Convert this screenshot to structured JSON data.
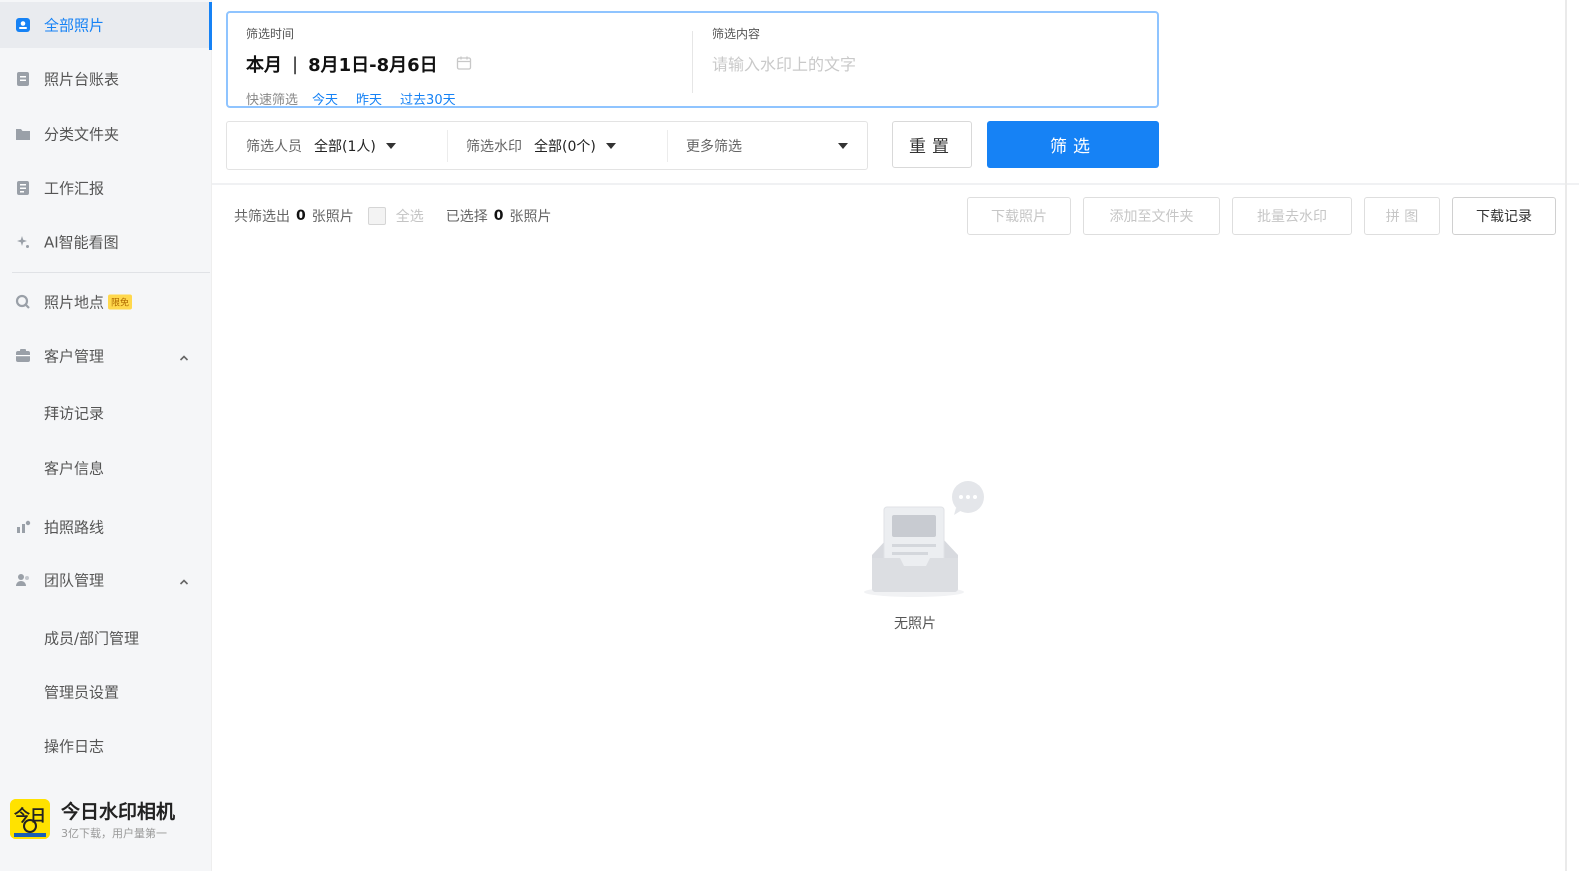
{
  "sidebar": {
    "items": [
      {
        "label": "全部照片",
        "icon": "photo-icon",
        "active": true
      },
      {
        "label": "照片台账表",
        "icon": "ledger-icon"
      },
      {
        "label": "分类文件夹",
        "icon": "folder-icon"
      },
      {
        "label": "工作汇报",
        "icon": "report-icon"
      },
      {
        "label": "AI智能看图",
        "icon": "ai-sparkle-icon"
      },
      {
        "label": "照片地点",
        "icon": "location-icon",
        "badge": "限免"
      },
      {
        "label": "客户管理",
        "icon": "customer-icon",
        "expanded": true
      },
      {
        "label": "拜访记录"
      },
      {
        "label": "客户信息"
      },
      {
        "label": "拍照路线",
        "icon": "route-icon"
      },
      {
        "label": "团队管理",
        "icon": "team-icon",
        "expanded": true
      },
      {
        "label": "成员/部门管理"
      },
      {
        "label": "管理员设置"
      },
      {
        "label": "操作日志"
      }
    ],
    "brand": {
      "name": "今日水印相机",
      "subtitle": "3亿下载，用户量第一",
      "logo_text": "今日"
    }
  },
  "filter": {
    "time_label": "筛选时间",
    "date_period": "本月",
    "date_range": "8月1日-8月6日",
    "quick_label": "快速筛选",
    "quick_links": [
      "今天",
      "昨天",
      "过去30天"
    ],
    "content_label": "筛选内容",
    "content_placeholder": "请输入水印上的文字",
    "content_value": ""
  },
  "filter_row": {
    "person_label": "筛选人员",
    "person_value": "全部(1人)",
    "watermark_label": "筛选水印",
    "watermark_value": "全部(0个)",
    "more_label": "更多筛选"
  },
  "buttons": {
    "reset": "重置",
    "filter": "筛选"
  },
  "results": {
    "total_prefix": "共筛选出",
    "total_count": "0",
    "total_suffix": "张照片",
    "select_all": "全选",
    "selected_prefix": "已选择",
    "selected_count": "0",
    "selected_suffix": "张照片"
  },
  "actions": {
    "download": "下载照片",
    "add_to_folder": "添加至文件夹",
    "remove_watermark": "批量去水印",
    "collage": "拼 图",
    "download_history": "下载记录"
  },
  "empty": {
    "text": "无照片"
  },
  "colors": {
    "accent": "#1682f5",
    "sidebar_bg": "#f5f6f8",
    "badge": "#ffd84d"
  }
}
